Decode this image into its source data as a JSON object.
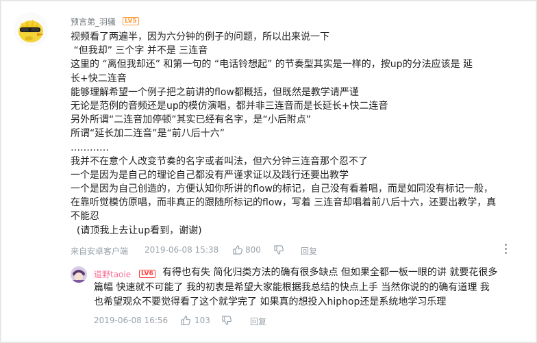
{
  "comment": {
    "username": "预言弟_羽骚",
    "level": "LV5",
    "lines": [
      "视频看了两遍半，因为六分钟的例子的问题，所以出来说一下",
      " “但我却” 三个字 并不是 三连音",
      "这里的 “离但我却还” 和第一句的 “电话铃想起” 的节奏型其实是一样的，按up的分法应该是 延",
      "长+快二连音",
      "能够理解希望一个例子把之前讲的flow都概括，但既然是教学请严谨",
      "无论是范例的音频还是up的模仿演唱，都并非三连音而是长延长+快二连音",
      "另外所谓“二连音加停顿”其实已经有名字，是“小后附点”",
      "所谓“延长加二连音”是“前八后十六”",
      "…………",
      "我并不在意个人改变节奏的名字或者叫法，但六分钟三连音那个忍不了",
      "一个是因为是自己的理论自己都没有严谨求证以及践行还要出教学",
      "一个是因为自己创造的，方便认知你所讲的flow的标记，自己没有看着唱，而是如同没有标记一般，",
      "在靠听觉模仿原唱，而非真正的跟随所标记的flow，写着 三连音却唱着前八后十六，还要出教学，真",
      "不能忍",
      "  (请顶我上去让up看到，谢谢)"
    ],
    "source": "来自安卓客户端",
    "time": "2019-06-08 15:38",
    "likes": "800",
    "reply_label": "回复"
  },
  "reply": {
    "username": "道野taoie",
    "level": "LV6",
    "lines": [
      "有得也有失 简化归类方法的确有很多缺点 但如果全都一板一眼的讲 就要花很多",
      "篇幅 快速就不可能了 我的初衷是希望大家能根据我总结的快点上手 当然你说的的确有道理 我",
      "也希望观众不要觉得看了这个就学完了 如果真的想投入hiphop还是系统地学习乐理"
    ],
    "time": "2019-06-08 16:56",
    "likes": "103",
    "reply_label": "回复"
  },
  "colors": {
    "username_main": "#6d757a",
    "username_reply": "#fb7299",
    "level_main": "#ff9b3a",
    "level_reply": "#ff3c3c",
    "meta": "#99a2aa"
  },
  "icons": [
    "like-icon",
    "dislike-icon",
    "more-icon"
  ]
}
